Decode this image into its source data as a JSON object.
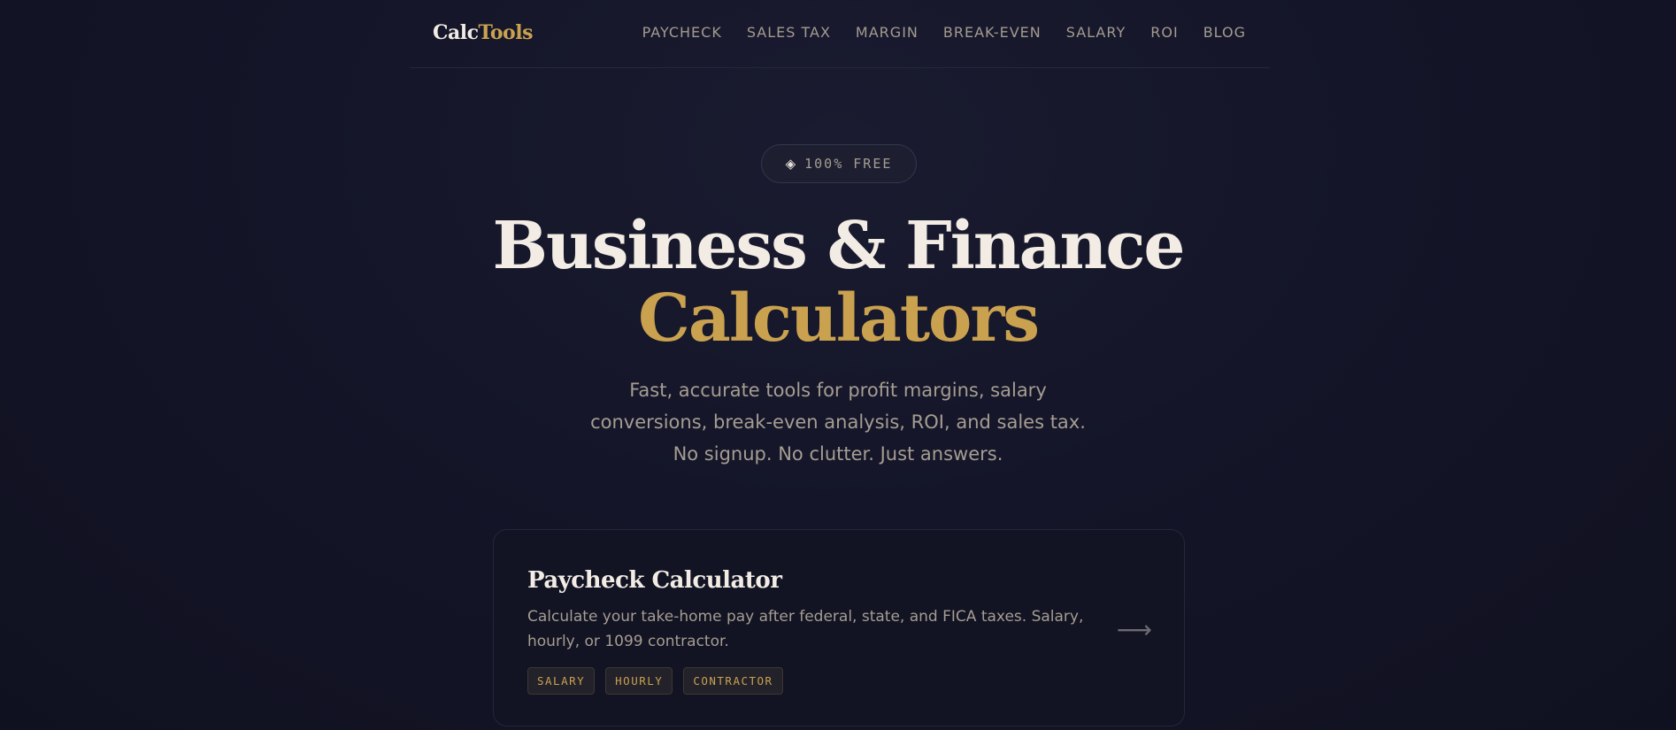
{
  "header": {
    "logo": {
      "part1": "Calc",
      "part2": "Tools"
    },
    "nav": [
      "PAYCHECK",
      "SALES TAX",
      "MARGIN",
      "BREAK-EVEN",
      "SALARY",
      "ROI",
      "BLOG"
    ]
  },
  "hero": {
    "badge": "100% FREE",
    "badge_icon": "diamond-icon",
    "title_line1": "Business & Finance",
    "title_line2": "Calculators",
    "subtitle": "Fast, accurate tools for profit margins, salary conversions, break-even analysis, ROI, and sales tax. No signup. No clutter. Just answers."
  },
  "cards": [
    {
      "title": "Paycheck Calculator",
      "description": "Calculate your take-home pay after federal, state, and FICA taxes. Salary, hourly, or 1099 contractor.",
      "tags": [
        "SALARY",
        "HOURLY",
        "CONTRACTOR"
      ],
      "arrow_icon": "arrow-right-icon"
    }
  ],
  "colors": {
    "background": "#141528",
    "accent": "#c9a14f",
    "heading": "#f2ece4",
    "muted": "#a69d92"
  }
}
